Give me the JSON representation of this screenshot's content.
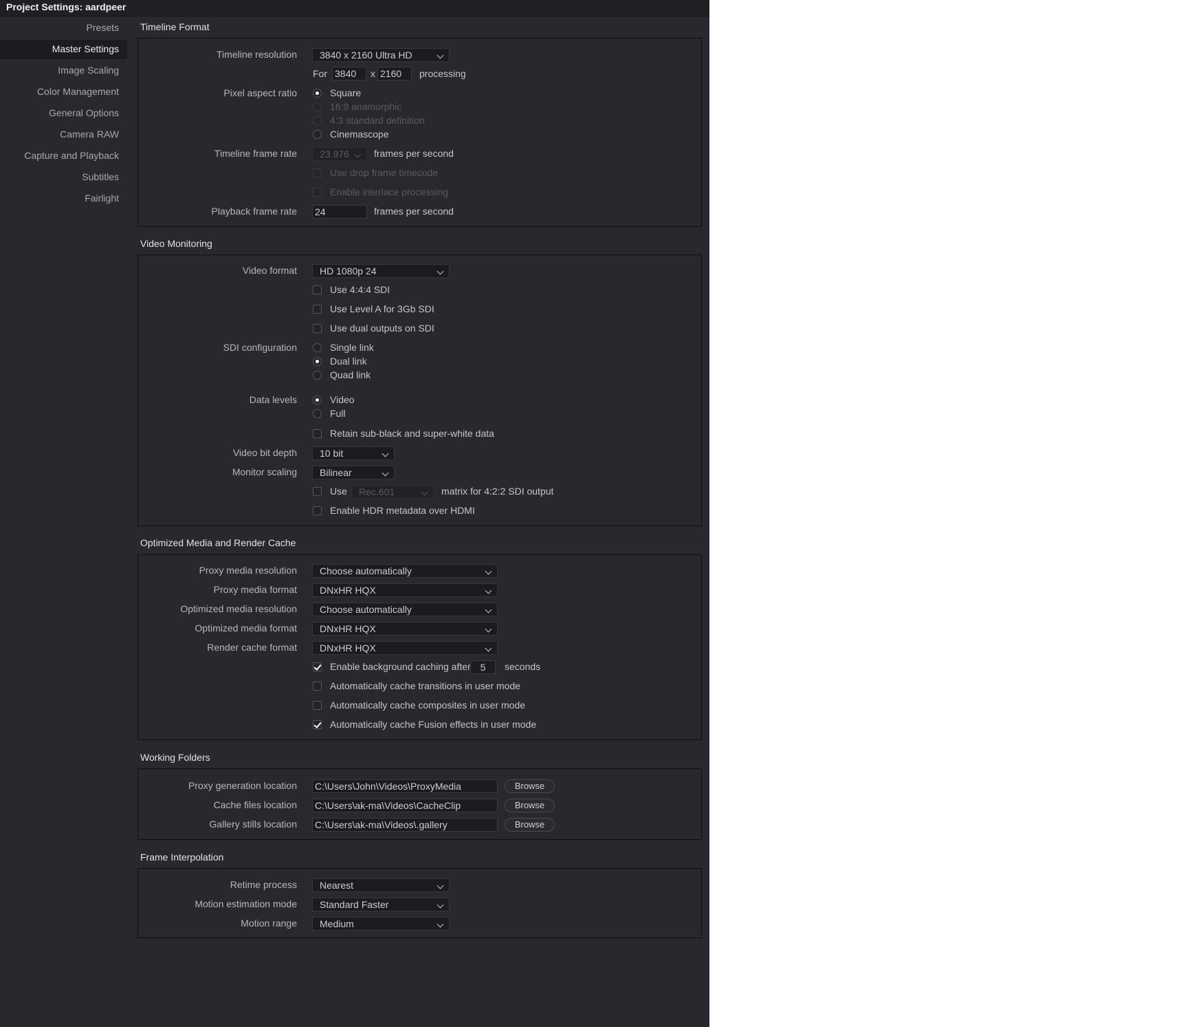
{
  "window": {
    "title": "Project Settings:  aardpeer"
  },
  "sidebar": {
    "items": [
      {
        "label": "Presets"
      },
      {
        "label": "Master Settings"
      },
      {
        "label": "Image Scaling"
      },
      {
        "label": "Color Management"
      },
      {
        "label": "General Options"
      },
      {
        "label": "Camera RAW"
      },
      {
        "label": "Capture and Playback"
      },
      {
        "label": "Subtitles"
      },
      {
        "label": "Fairlight"
      }
    ],
    "active": "Master Settings"
  },
  "timeline_format": {
    "title": "Timeline Format",
    "resolution_label": "Timeline resolution",
    "resolution_value": "3840 x 2160 Ultra HD",
    "for_label": "For",
    "width": "3840",
    "x_label": "x",
    "height": "2160",
    "processing_label": "processing",
    "pixel_aspect_label": "Pixel aspect ratio",
    "pixel_aspect_options": [
      "Square",
      "16:9 anamorphic",
      "4:3 standard definition",
      "Cinemascope"
    ],
    "pixel_aspect_selected": "Square",
    "frame_rate_label": "Timeline frame rate",
    "frame_rate_value": "23.976",
    "fps_label": "frames per second",
    "drop_frame_label": "Use drop frame timecode",
    "interlace_label": "Enable interlace processing",
    "playback_rate_label": "Playback frame rate",
    "playback_rate_value": "24",
    "playback_fps_label": "frames per second"
  },
  "video_monitoring": {
    "title": "Video Monitoring",
    "format_label": "Video format",
    "format_value": "HD 1080p 24",
    "use_444_label": "Use 4:4:4 SDI",
    "use_level_a_label": "Use Level A for 3Gb SDI",
    "dual_outputs_label": "Use dual outputs on SDI",
    "sdi_label": "SDI configuration",
    "sdi_options": [
      "Single link",
      "Dual link",
      "Quad link"
    ],
    "sdi_selected": "Dual link",
    "data_levels_label": "Data levels",
    "data_levels_options": [
      "Video",
      "Full"
    ],
    "data_levels_selected": "Video",
    "retain_label": "Retain sub-black and super-white data",
    "bit_depth_label": "Video bit depth",
    "bit_depth_value": "10 bit",
    "scaling_label": "Monitor scaling",
    "scaling_value": "Bilinear",
    "use_label": "Use",
    "matrix_value": "Rec.601",
    "matrix_label": "matrix for 4:2:2 SDI output",
    "hdr_label": "Enable HDR metadata over HDMI"
  },
  "optimized_media": {
    "title": "Optimized Media and Render Cache",
    "proxy_res_label": "Proxy media resolution",
    "proxy_res_value": "Choose automatically",
    "proxy_format_label": "Proxy media format",
    "proxy_format_value": "DNxHR HQX",
    "opt_res_label": "Optimized media resolution",
    "opt_res_value": "Choose automatically",
    "opt_format_label": "Optimized media format",
    "opt_format_value": "DNxHR HQX",
    "render_format_label": "Render cache format",
    "render_format_value": "DNxHR HQX",
    "bg_cache_label": "Enable background caching after",
    "bg_cache_seconds": "5",
    "seconds_label": "seconds",
    "cache_transitions_label": "Automatically cache transitions in user mode",
    "cache_composites_label": "Automatically cache composites in user mode",
    "cache_fusion_label": "Automatically cache Fusion effects in user mode"
  },
  "working_folders": {
    "title": "Working Folders",
    "proxy_loc_label": "Proxy generation location",
    "proxy_loc_value": "C:\\Users\\John\\Videos\\ProxyMedia",
    "cache_loc_label": "Cache files location",
    "cache_loc_value": "C:\\Users\\ak-ma\\Videos\\CacheClip",
    "gallery_loc_label": "Gallery stills location",
    "gallery_loc_value": "C:\\Users\\ak-ma\\Videos\\.gallery",
    "browse_label": "Browse"
  },
  "frame_interpolation": {
    "title": "Frame Interpolation",
    "retime_label": "Retime process",
    "retime_value": "Nearest",
    "motion_mode_label": "Motion estimation mode",
    "motion_mode_value": "Standard Faster",
    "motion_range_label": "Motion range",
    "motion_range_value": "Medium"
  }
}
